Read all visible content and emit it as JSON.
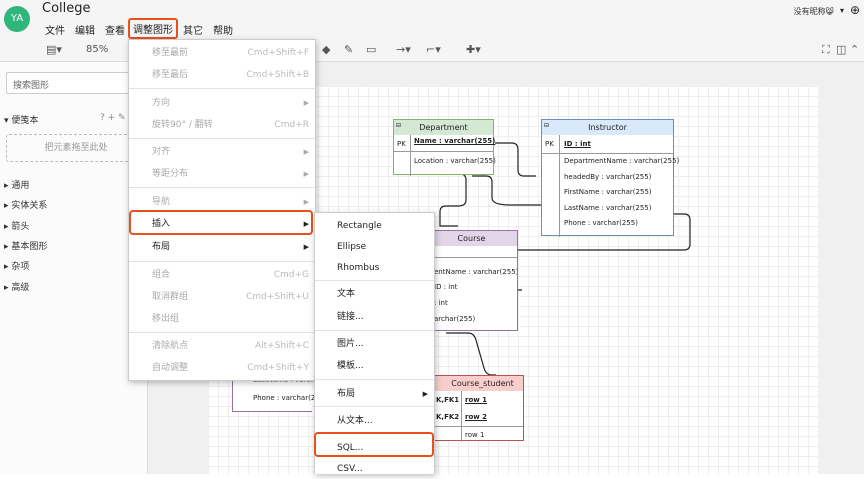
{
  "app": {
    "logo": "YA",
    "title": "College",
    "user": "没有昵称😸"
  },
  "menubar": [
    "文件",
    "编辑",
    "查看",
    "调整图形",
    "其它",
    "帮助"
  ],
  "toolbar": {
    "zoom": "85%"
  },
  "sidebar": {
    "search_placeholder": "搜索图形",
    "scratchpad": "便笺本",
    "drop_hint": "把元素拖至此处",
    "sections": [
      "通用",
      "实体关系",
      "箭头",
      "基本图形",
      "杂项",
      "高级"
    ]
  },
  "arrange_menu": [
    {
      "label": "移至最前",
      "shortcut": "Cmd+Shift+F",
      "disabled": true
    },
    {
      "label": "移至最后",
      "shortcut": "Cmd+Shift+B",
      "disabled": true
    },
    {
      "label": "方向",
      "disabled": true
    },
    {
      "label": "旋转90° / 翻转",
      "shortcut": "Cmd+R",
      "disabled": true
    },
    {
      "label": "对齐",
      "disabled": true
    },
    {
      "label": "等距分布",
      "disabled": true
    },
    {
      "label": "导航",
      "disabled": true
    },
    {
      "label": "插入",
      "disabled": false
    },
    {
      "label": "布局",
      "disabled": false
    },
    {
      "label": "组合",
      "shortcut": "Cmd+G",
      "disabled": true
    },
    {
      "label": "取消群组",
      "shortcut": "Cmd+Shift+U",
      "disabled": true
    },
    {
      "label": "移出组",
      "disabled": true
    },
    {
      "label": "清除航点",
      "shortcut": "Alt+Shift+C",
      "disabled": true
    },
    {
      "label": "自动调整",
      "shortcut": "Cmd+Shift+Y",
      "disabled": true
    }
  ],
  "insert_menu": [
    "Rectangle",
    "Ellipse",
    "Rhombus",
    "文本",
    "链接...",
    "图片...",
    "模板...",
    "布局",
    "从文本...",
    "SQL...",
    "CSV..."
  ],
  "diagram": {
    "department": {
      "title": "Department",
      "pk": "PK",
      "key": "Name : varchar(255)",
      "fields": [
        "Location : varchar(255)"
      ]
    },
    "instructor": {
      "title": "Instructor",
      "pk": "PK",
      "key": "ID : int",
      "fields": [
        "DepartmentName : varchar(255)",
        "headedBy : varchar(255)",
        "FirstName : varchar(255)",
        "LastName : varchar(255)",
        "Phone : varchar(255)"
      ]
    },
    "course": {
      "title": "Course",
      "fields": [
        "entName : varchar(255)",
        "ID : int",
        ": int",
        "archar(255)"
      ]
    },
    "course_student": {
      "title": "Course_student",
      "keys": [
        "K,FK1",
        "K,FK2"
      ],
      "rows": [
        "row 1",
        "row 2",
        "row 1"
      ]
    },
    "left_partial": {
      "fields": [
        "LastName : varchar",
        "Phone : varchar(25"
      ]
    }
  }
}
